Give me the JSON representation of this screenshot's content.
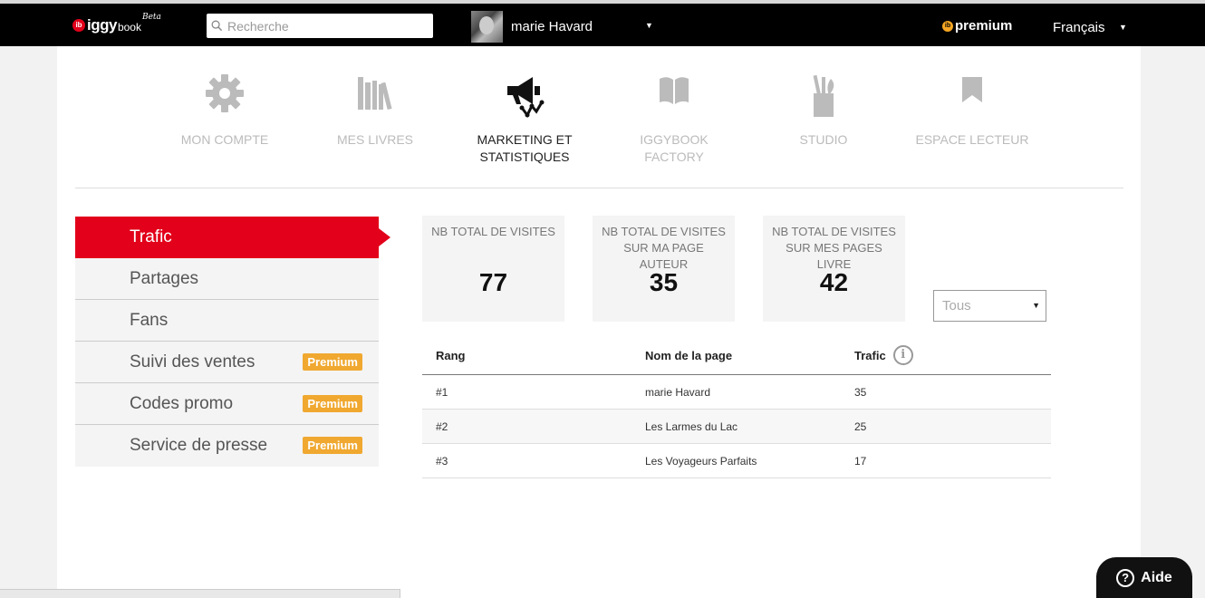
{
  "header": {
    "logo": {
      "iggy": "iggy",
      "book": "book",
      "beta": "Beta",
      "mark": "ib"
    },
    "search_placeholder": "Recherche",
    "user_name": "marie Havard",
    "premium_label": "premium",
    "premium_mark": "ib",
    "language": "Français",
    "caret": "▼"
  },
  "nav": [
    {
      "label": "MON COMPTE",
      "icon": "gear-icon"
    },
    {
      "label": "MES LIVRES",
      "icon": "books-icon"
    },
    {
      "label": "MARKETING ET STATISTIQUES",
      "icon": "megaphone-chart-icon"
    },
    {
      "label": "IGGYBOOK FACTORY",
      "icon": "open-book-icon"
    },
    {
      "label": "STUDIO",
      "icon": "pencil-cup-icon"
    },
    {
      "label": "ESPACE LECTEUR",
      "icon": "bookmark-icon"
    }
  ],
  "sidebar": [
    {
      "label": "Trafic"
    },
    {
      "label": "Partages"
    },
    {
      "label": "Fans"
    },
    {
      "label": "Suivi des ventes",
      "badge": "Premium"
    },
    {
      "label": "Codes promo",
      "badge": "Premium"
    },
    {
      "label": "Service de presse",
      "badge": "Premium"
    }
  ],
  "stats": [
    {
      "label": "NB TOTAL DE VISITES",
      "value": "77"
    },
    {
      "label": "NB TOTAL DE VISITES SUR MA PAGE AUTEUR",
      "value": "35"
    },
    {
      "label": "NB TOTAL DE VISITES SUR MES PAGES LIVRE",
      "value": "42"
    }
  ],
  "filter": {
    "value": "Tous",
    "caret": "▼"
  },
  "table": {
    "headers": [
      "Rang",
      "Nom de la page",
      "Trafic"
    ],
    "info_icon": "i",
    "rows": [
      [
        "#1",
        "marie Havard",
        "35"
      ],
      [
        "#2",
        "Les Larmes du Lac",
        "25"
      ],
      [
        "#3",
        "Les Voyageurs Parfaits",
        "17"
      ]
    ]
  },
  "help": {
    "label": "Aide",
    "icon": "?"
  },
  "colors": {
    "accent": "#e2001a",
    "premium_badge": "#f0a830",
    "topbar": "#000000"
  }
}
